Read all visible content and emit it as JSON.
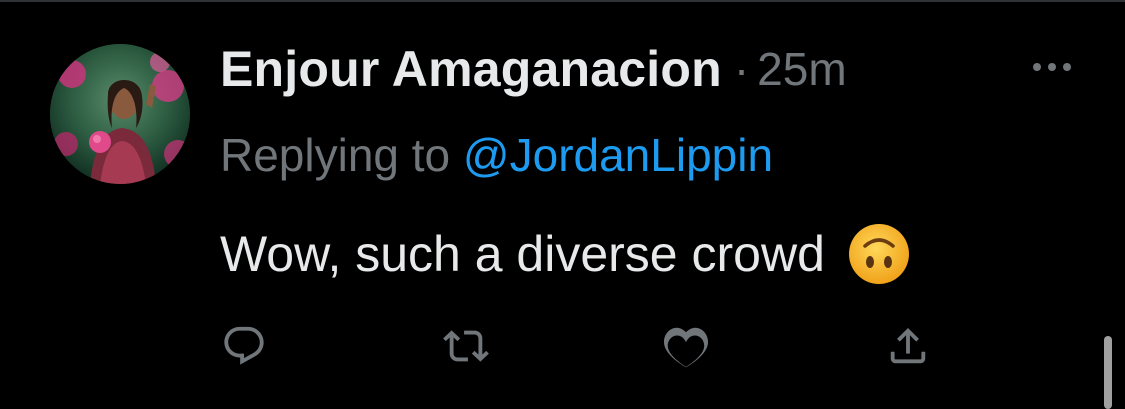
{
  "tweet": {
    "display_name": "Enjour Amaganacion",
    "separator": "·",
    "timestamp": "25m",
    "replying_prefix": "Replying to",
    "replying_handle": "@JordanLippin",
    "text": "Wow, such a diverse crowd",
    "emoji": "upside-down-face"
  },
  "actions": [
    "reply-icon",
    "retweet-icon",
    "like-icon",
    "share-icon"
  ],
  "colors": {
    "background": "#000000",
    "primary_text": "#e7e9ea",
    "secondary_text": "#71767b",
    "link": "#1d9bf0",
    "emoji_face": "#f7c33a"
  }
}
